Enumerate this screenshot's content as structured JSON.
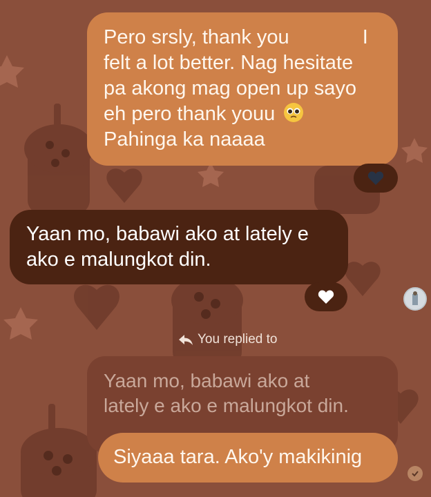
{
  "theme": {
    "background": "#8a4f3b",
    "sent_bubble": "#cf8149",
    "received_bubble": "#4b2312",
    "quoted_bubble": "#7a4130",
    "decoration": "#6e3b2b"
  },
  "messages": [
    {
      "direction": "sent",
      "lines": [
        "Pero srsly, thank you",
        "felt a lot better. Nag hesitate",
        "pa akong mag open up sayo",
        "eh pero thank youu",
        "Pahinga ka naaaa"
      ],
      "line1_tail": "I",
      "emoji": "pleading-face",
      "reaction": "dark-heart-icon"
    },
    {
      "direction": "received",
      "lines": [
        "Yaan mo, babawi ako at lately e",
        "ako e malungkot din."
      ],
      "reaction": "white-heart-icon"
    }
  ],
  "reply": {
    "label": "You replied to",
    "quoted_lines": [
      "Yaan mo, babawi ako at",
      "lately e ako e malungkot din."
    ],
    "message": "Siyaaa tara. Ako'y makikinig"
  }
}
